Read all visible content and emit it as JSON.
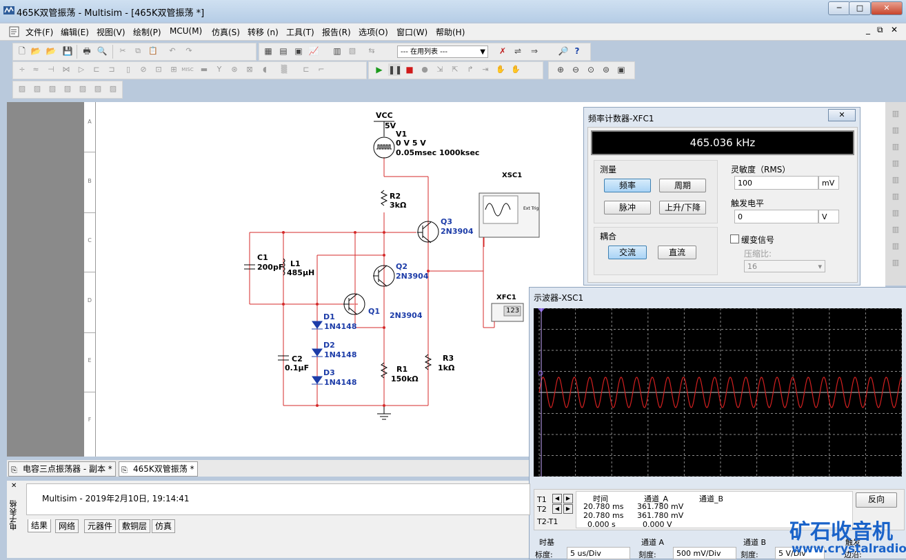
{
  "window": {
    "title": "465K双管振荡 - Multisim - [465K双管振荡 *]",
    "min_label": "─",
    "max_label": "□",
    "close_label": "✕",
    "mdi_buttons": [
      "_",
      "⧉",
      "✕"
    ]
  },
  "menu": [
    "文件(F)",
    "编辑(E)",
    "视图(V)",
    "绘制(P)",
    "MCU(M)",
    "仿真(S)",
    "转移 (n)",
    "工具(T)",
    "报告(R)",
    "选项(O)",
    "窗口(W)",
    "帮助(H)"
  ],
  "toolbar": {
    "in_use_list": "--- 在用列表 ---"
  },
  "ruler": [
    "A",
    "B",
    "C",
    "D",
    "E",
    "F"
  ],
  "schematic": {
    "vcc": "VCC",
    "vcc_value": "5V",
    "v1_name": "V1",
    "v1_line1": "0 V 5 V",
    "v1_line2": "0.05msec 1000ksec",
    "r2": "R2",
    "r2_value": "3kΩ",
    "q3": "Q3",
    "q3_model": "2N3904",
    "xsc1": "XSC1",
    "ext_trig": "Ext Trig",
    "c1": "C1",
    "c1_value": "200pF",
    "l1": "L1",
    "l1_value": "485µH",
    "q2": "Q2",
    "q2_model": "2N3904",
    "xfc1": "XFC1",
    "xfc1_display": "123",
    "q1": "Q1",
    "q1_model": "2N3904",
    "d1": "D1",
    "d1_model": "1N4148",
    "d2": "D2",
    "d2_model": "1N4148",
    "d3": "D3",
    "d3_model": "1N4148",
    "c2": "C2",
    "c2_value": "0.1µF",
    "r1": "R1",
    "r1_value": "150kΩ",
    "r3": "R3",
    "r3_value": "1kΩ"
  },
  "freq_counter": {
    "title": "频率计数器-XFC1",
    "close": "✕",
    "reading": "465.036 kHz",
    "measure_label": "测量",
    "btn_freq": "频率",
    "btn_period": "周期",
    "btn_pulse": "脉冲",
    "btn_rise_fall": "上升/下降",
    "coupling_label": "耦合",
    "btn_ac": "交流",
    "btn_dc": "直流",
    "sensitivity_label": "灵敏度（RMS）",
    "sensitivity_value": "100",
    "sensitivity_unit": "mV",
    "trigger_label": "触发电平",
    "trigger_value": "0",
    "trigger_unit": "V",
    "slow_signal_label": "缓变信号",
    "compression_label": "压缩比:",
    "compression_value": "16"
  },
  "scope": {
    "title": "示波器-XSC1",
    "t1": "T1",
    "t2": "T2",
    "t2t1": "T2-T1",
    "col_time": "时间",
    "col_a": "通道_A",
    "col_b": "通道_B",
    "r1_time": "20.780 ms",
    "r1_a": "361.780 mV",
    "r2_time": "20.780 ms",
    "r2_a": "361.780 mV",
    "r3_time": "0.000 s",
    "r3_a": "0.000 V",
    "btn_reverse": "反向",
    "timebase_label": "时基",
    "timebase_scale_label": "标度:",
    "timebase_scale": "5 us/Div",
    "cha_label": "通道 A",
    "cha_scale_label": "刻度:",
    "cha_scale": "500 mV/Div",
    "chb_label": "通道 B",
    "chb_scale_label": "刻度:",
    "chb_scale": "5 V/Div",
    "trigger_label": "触发",
    "trigger_edge_label": "边沿:"
  },
  "doc_tabs": [
    "电容三点振荡器 - 副本 *",
    "465K双管振荡 *"
  ],
  "output": {
    "close": "✕",
    "side_label": "电子表格",
    "message": "Multisim  -  2019年2月10日, 19:14:41",
    "tabs": [
      "结果",
      "网络",
      "元器件",
      "敷铜层",
      "仿真"
    ]
  },
  "watermark": {
    "line1": "矿石收音机",
    "line2": "www.crystalradio.cn"
  }
}
